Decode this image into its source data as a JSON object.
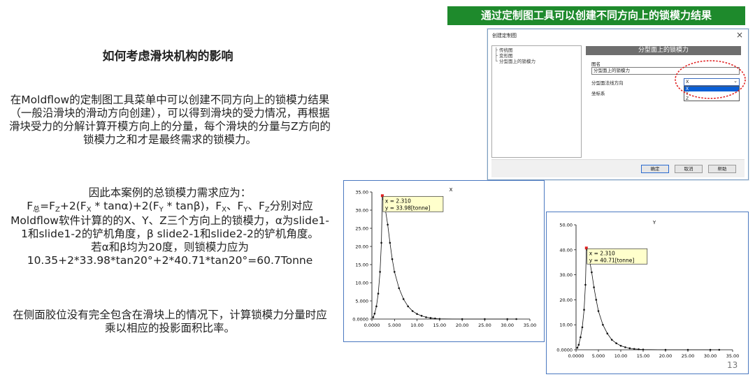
{
  "slide": {
    "title": "如何考虑滑块机构的影响",
    "para1": "在Moldflow的定制图工具菜单中可以创建不同方向上的锁模力结果（一般沿滑块的滑动方向创建），可以得到滑块的受力情况，再根据滑块受力的分解计算开模方向上的分量，每个滑块的分量与Z方向的锁模力之和才是最终需求的锁模力。",
    "para2_intro": "因此本案例的总锁模力需求应为：",
    "formula": {
      "f": "F",
      "sub_total": "总",
      "eq": "=F",
      "sub_z1": "Z",
      "t1": "+2(F",
      "sub_x1": "X",
      "t2": " * tanα)+2(F",
      "sub_y1": "Y",
      "t3": " * tanβ)，F",
      "sub_x2": "X",
      "t4": "、F",
      "sub_y2": "Y",
      "t5": "、F",
      "sub_z2": "Z",
      "t6": "分别对应"
    },
    "para2_rest": "Moldflow软件计算的的X、Y、Z三个方向上的锁模力，α为slide1-1和slide1-2的铲机角度，β slide2-1和slide2-2的铲机角度。",
    "para2_angle": "若α和β均为20度，则锁模力应为",
    "para2_calc": "10.35+2*33.98*tan20°+2*40.71*tan20°=60.7Tonne",
    "para3": "在侧面胶位没有完全包含在滑块上的情况下，计算锁模力分量时应乘以相应的投影面积比率。",
    "banner": "通过定制图工具可以创建不同方向上的锁模力结果",
    "page_number": "13"
  },
  "dialog": {
    "title": "创建定制图",
    "close": "×",
    "tree": [
      "传统图",
      "变形图",
      "分型面上的锁模力"
    ],
    "header": "分型面上的锁模力",
    "name_label": "图名",
    "name_value": "分型面上的锁模力",
    "direction_label": "分型面法线方向",
    "direction_value": "X",
    "direction_options": [
      "X",
      "Y",
      "Z"
    ],
    "coord_label": "坐标系",
    "ok": "确定",
    "cancel": "取消",
    "help": "帮助",
    "highlight_color": "#e02020"
  },
  "chart_data": [
    {
      "type": "line",
      "title": "X",
      "x": [
        0.3,
        0.6,
        1.0,
        1.4,
        1.8,
        2.1,
        2.31,
        2.5,
        3.0,
        3.5,
        4.0,
        4.5,
        5.0,
        6.0,
        7.0,
        8.0,
        9.0,
        10.0,
        11.0,
        12.0,
        13.0,
        14.0,
        15.0,
        20.0,
        25.0,
        30.0,
        32.0
      ],
      "y": [
        0.5,
        1.5,
        3.5,
        7.0,
        13.0,
        21.0,
        33.98,
        33.0,
        30.0,
        26.0,
        21.0,
        16.5,
        13.0,
        8.5,
        5.5,
        3.5,
        2.2,
        1.4,
        0.9,
        0.5,
        0.3,
        0.15,
        0.05,
        0.0,
        0.0,
        0.0,
        0.0
      ],
      "xlim": [
        0,
        35
      ],
      "ylim": [
        0,
        35
      ],
      "xticks": [
        "0.0000",
        "5.000",
        "10.00",
        "15.00",
        "20.00",
        "25.00",
        "30.00",
        "35.00"
      ],
      "yticks": [
        "0.0000",
        "5.000",
        "10.00",
        "15.00",
        "20.00",
        "25.00",
        "30.00",
        "35.00"
      ],
      "tooltip_x": "x = 2.310",
      "tooltip_y": "y = 33.98[tonne]"
    },
    {
      "type": "line",
      "title": "Y",
      "x": [
        0.3,
        0.6,
        1.0,
        1.4,
        1.8,
        2.1,
        2.31,
        2.5,
        3.0,
        3.5,
        4.0,
        4.5,
        5.0,
        6.0,
        7.0,
        8.0,
        9.0,
        10.0,
        11.0,
        12.0,
        13.0,
        14.0,
        15.0,
        20.0,
        25.0,
        30.0,
        32.0
      ],
      "y": [
        0.8,
        2.0,
        5.0,
        9.0,
        16.0,
        26.0,
        40.71,
        40.0,
        36.0,
        31.0,
        25.0,
        20.0,
        15.5,
        10.0,
        6.5,
        4.0,
        2.6,
        1.6,
        1.0,
        0.6,
        0.35,
        0.2,
        0.1,
        0.0,
        0.0,
        0.0,
        0.0
      ],
      "xlim": [
        0,
        35
      ],
      "ylim": [
        0,
        50
      ],
      "xticks": [
        "0.0000",
        "5.000",
        "10.00",
        "15.00",
        "20.00",
        "25.00",
        "30.00",
        "35.00"
      ],
      "yticks": [
        "0.0000",
        "10.00",
        "20.00",
        "30.00",
        "40.00",
        "50.00"
      ],
      "tooltip_x": "x = 2.310",
      "tooltip_y": "y = 40.71[tonne]"
    }
  ]
}
